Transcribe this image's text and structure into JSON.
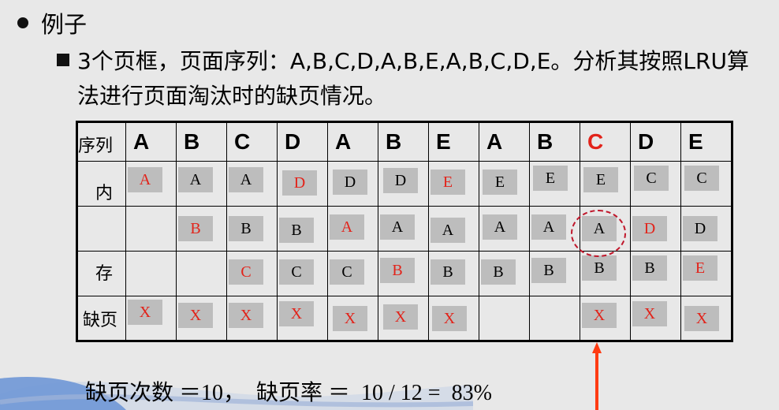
{
  "heading": "例子",
  "paragraph": "3个页框，页面序列：A,B,C,D,A,B,E,A,B,C,D,E。分析其按照LRU算法进行页面淘汰时的缺页情况。",
  "table": {
    "corner_label": "序列",
    "mem_label_top": "内",
    "mem_label_bottom": "存",
    "fault_label": "缺页",
    "sequence": [
      "A",
      "B",
      "C",
      "D",
      "A",
      "B",
      "E",
      "A",
      "B",
      "C",
      "D",
      "E"
    ],
    "row1": [
      "A",
      "A",
      "A",
      "D",
      "D",
      "D",
      "E",
      "E",
      "E",
      "E",
      "C",
      "C"
    ],
    "row2": [
      "",
      "B",
      "B",
      "B",
      "A",
      "A",
      "A",
      "A",
      "A",
      "A",
      "D",
      "D"
    ],
    "row3": [
      "",
      "",
      "C",
      "C",
      "C",
      "B",
      "B",
      "B",
      "B",
      "B",
      "B",
      "E"
    ],
    "faults": [
      "X",
      "X",
      "X",
      "X",
      "X",
      "X",
      "X",
      "",
      "",
      "X",
      "X",
      "X"
    ]
  },
  "highlight_column_index": 9,
  "colors": {
    "red": "#e2231a",
    "box_gray": "#bdbdbd",
    "background": "#e8e8e8",
    "circle": "#c0172b",
    "arrow": "#ff3b12"
  },
  "footer": "缺页次数 ＝10，  缺页率 ＝  10 / 12 =  83%"
}
